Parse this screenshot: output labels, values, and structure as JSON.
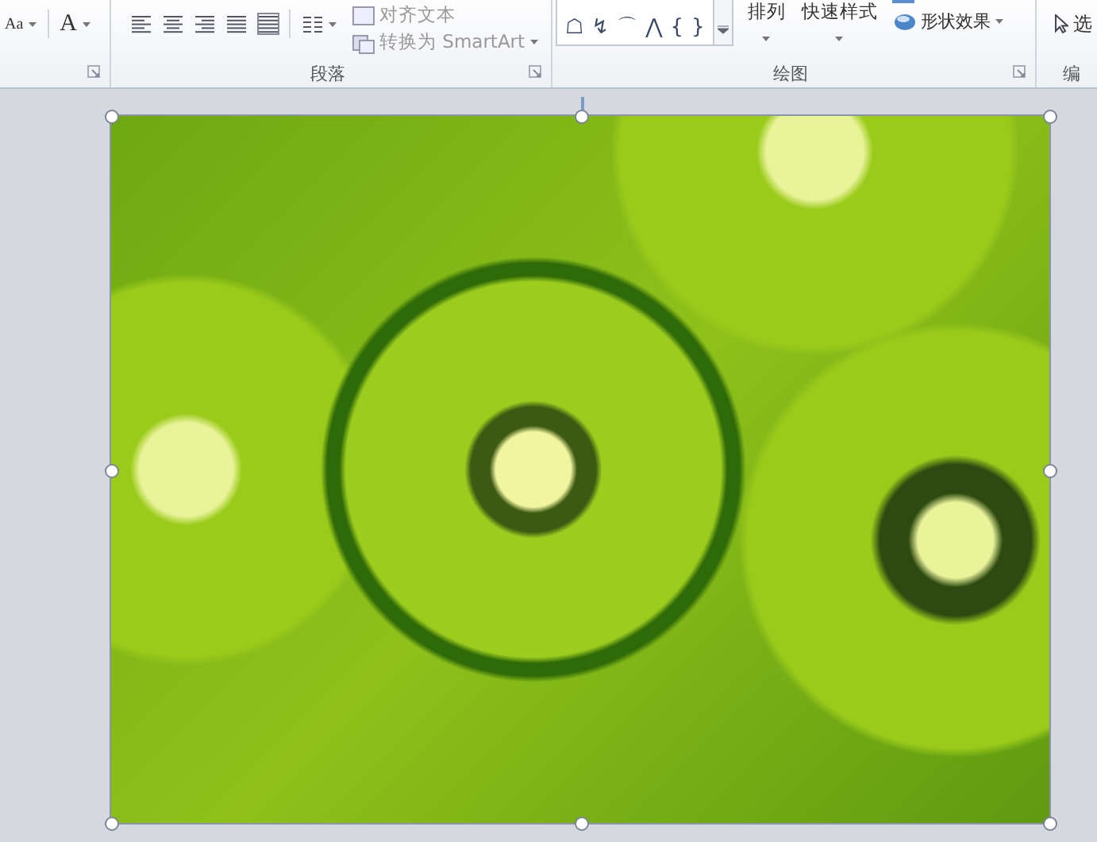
{
  "ribbon": {
    "font_group": {
      "buttons": [
        {
          "label": "Aa"
        },
        {
          "label": "A"
        }
      ]
    },
    "paragraph_group": {
      "label": "段落",
      "text_direction": "对齐文本",
      "smartart": "转换为 SmartArt"
    },
    "drawing_group": {
      "label": "绘图",
      "shapes": [
        "☖",
        "↯",
        "⌒",
        "⋀",
        "{",
        "}"
      ],
      "arrange": "排列",
      "quick_styles": "快速样式",
      "shape_effects": "形状效果"
    },
    "editing_group": {
      "select": "选",
      "label": "编"
    }
  },
  "slide": {
    "picture": {
      "selected": true
    }
  }
}
